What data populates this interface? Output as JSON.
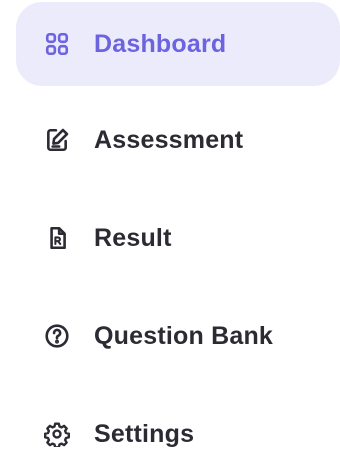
{
  "sidebar": {
    "accent_color": "#6b63e0",
    "active_background": "#ecebfb",
    "text_color": "#2b2b33",
    "items": [
      {
        "label": "Dashboard",
        "icon": "grid-icon",
        "active": true
      },
      {
        "label": "Assessment",
        "icon": "edit-document-icon",
        "active": false
      },
      {
        "label": "Result",
        "icon": "document-icon",
        "active": false
      },
      {
        "label": "Question Bank",
        "icon": "question-circle-icon",
        "active": false
      },
      {
        "label": "Settings",
        "icon": "gear-icon",
        "active": false
      }
    ]
  }
}
